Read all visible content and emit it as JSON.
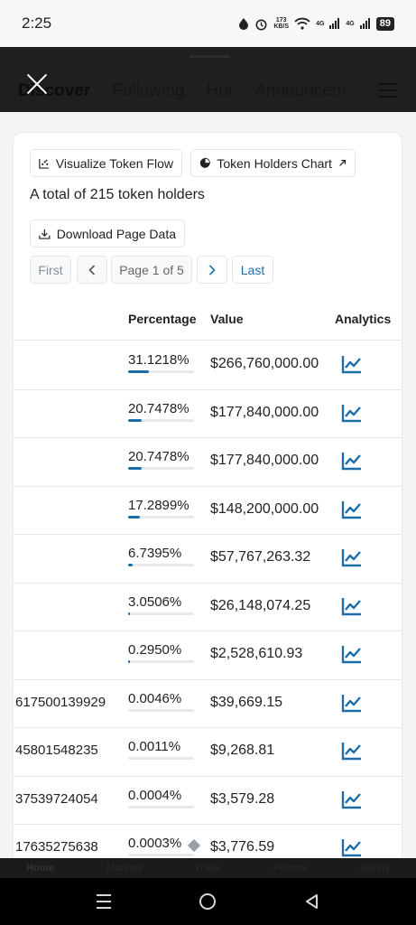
{
  "status_bar": {
    "time": "2:25",
    "net_speed_value": "173",
    "net_speed_unit": "KB/S",
    "signal1": "4G",
    "signal2": "4G",
    "battery": "89"
  },
  "header": {
    "tabs": [
      "Discover",
      "Following",
      "Hot",
      "Announcem"
    ]
  },
  "toolbar": {
    "visualize_label": "Visualize Token Flow",
    "holders_chart_label": "Token Holders Chart",
    "holders_total_text": "A total of 215 token holders",
    "download_label": "Download Page Data"
  },
  "pagination": {
    "first": "First",
    "info": "Page 1 of 5",
    "last": "Last"
  },
  "table": {
    "headers": {
      "percentage": "Percentage",
      "value": "Value",
      "analytics": "Analytics"
    },
    "rows": [
      {
        "address": "",
        "percentage": "31.1218%",
        "share": 0.311218,
        "value": "$266,760,000.00"
      },
      {
        "address": "",
        "percentage": "20.7478%",
        "share": 0.207478,
        "value": "$177,840,000.00"
      },
      {
        "address": "",
        "percentage": "20.7478%",
        "share": 0.207478,
        "value": "$177,840,000.00"
      },
      {
        "address": "",
        "percentage": "17.2899%",
        "share": 0.172899,
        "value": "$148,200,000.00"
      },
      {
        "address": "",
        "percentage": "6.7395%",
        "share": 0.067395,
        "value": "$57,767,263.32"
      },
      {
        "address": "",
        "percentage": "3.0506%",
        "share": 0.030506,
        "value": "$26,148,074.25"
      },
      {
        "address": "",
        "percentage": "0.2950%",
        "share": 0.00295,
        "value": "$2,528,610.93"
      },
      {
        "address": "617500139929",
        "percentage": "0.0046%",
        "share": 4.6e-05,
        "value": "$39,669.15"
      },
      {
        "address": "45801548235",
        "percentage": "0.0011%",
        "share": 1.1e-05,
        "value": "$9,268.81"
      },
      {
        "address": "37539724054",
        "percentage": "0.0004%",
        "share": 4e-06,
        "value": "$3,579.28"
      },
      {
        "address": "17635275638",
        "percentage": "0.0003%",
        "share": 3e-06,
        "value": "$3,776.59"
      }
    ]
  },
  "bottom_tabs": [
    "Home",
    "Markets",
    "Trade",
    "Futures",
    "Assets"
  ],
  "colors": {
    "accent": "#1e6da8",
    "overlay": "#1f1f1f"
  }
}
